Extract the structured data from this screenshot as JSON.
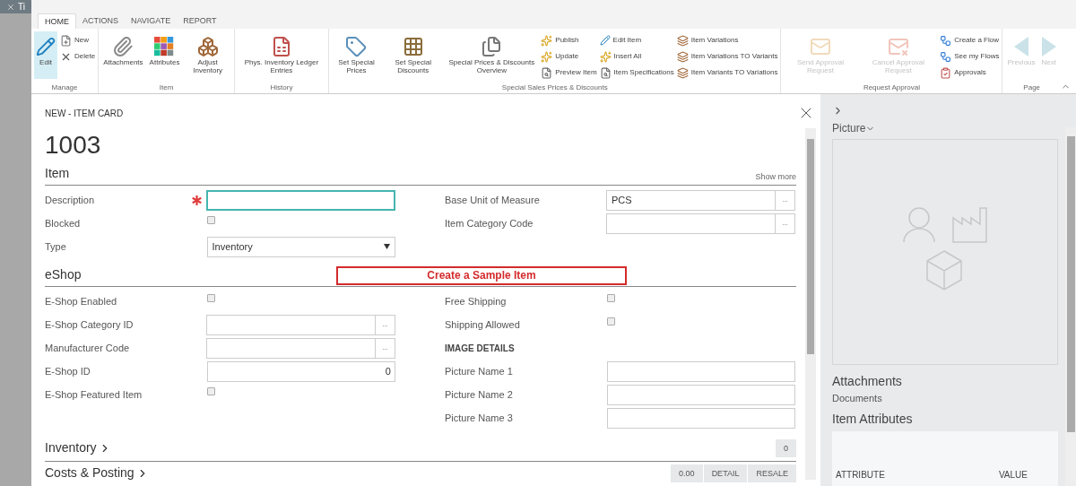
{
  "background": {
    "tab": "Ti"
  },
  "ribbon": {
    "tabs": [
      {
        "label": "HOME",
        "selected": true
      },
      {
        "label": "ACTIONS",
        "selected": false
      },
      {
        "label": "NAVIGATE",
        "selected": false
      },
      {
        "label": "REPORT",
        "selected": false
      }
    ],
    "groups": [
      {
        "label": "Manage",
        "columns": [
          {
            "kind": "large",
            "items": [
              {
                "label": "Edit",
                "selected": true,
                "disabled": false
              }
            ]
          },
          {
            "kind": "stack",
            "items": [
              {
                "label": "New",
                "disabled": false
              },
              {
                "label": "Delete",
                "disabled": false
              }
            ]
          }
        ]
      },
      {
        "label": "Item",
        "columns": [
          {
            "kind": "large",
            "items": [
              {
                "label": "Attachments",
                "selected": false,
                "disabled": false
              }
            ]
          },
          {
            "kind": "large",
            "items": [
              {
                "label": "Attributes",
                "selected": false,
                "disabled": false
              }
            ]
          },
          {
            "kind": "large",
            "items": [
              {
                "label": "Adjust Inventory",
                "selected": false,
                "disabled": false
              }
            ]
          }
        ]
      },
      {
        "label": "History",
        "columns": [
          {
            "kind": "large",
            "items": [
              {
                "label": "Phys. Inventory Ledger Entries",
                "selected": false,
                "disabled": false
              }
            ]
          }
        ]
      },
      {
        "label": "Special Sales Prices & Discounts",
        "columns": [
          {
            "kind": "large",
            "items": [
              {
                "label": "Set Special Prices",
                "selected": false,
                "disabled": false
              }
            ]
          },
          {
            "kind": "large",
            "items": [
              {
                "label": "Set Special Discounts",
                "selected": false,
                "disabled": false
              }
            ]
          },
          {
            "kind": "large",
            "items": [
              {
                "label": "Special Prices & Discounts Overview",
                "selected": false,
                "disabled": false
              }
            ]
          },
          {
            "kind": "stack",
            "items": [
              {
                "label": "Publish",
                "disabled": false
              },
              {
                "label": "Update",
                "disabled": false
              },
              {
                "label": "Preview Item",
                "disabled": false
              }
            ]
          },
          {
            "kind": "stack",
            "items": [
              {
                "label": "Edit Item",
                "disabled": false
              },
              {
                "label": "Insert All",
                "disabled": false
              },
              {
                "label": "Item Specifications",
                "disabled": false
              }
            ]
          },
          {
            "kind": "stack",
            "items": [
              {
                "label": "Item Variations",
                "disabled": false
              },
              {
                "label": "Item Variations TO Variants",
                "disabled": false
              },
              {
                "label": "Item Variants TO Variations",
                "disabled": false
              }
            ]
          }
        ]
      },
      {
        "label": "Request Approval",
        "columns": [
          {
            "kind": "large",
            "items": [
              {
                "label": "Send Approval Request",
                "selected": false,
                "disabled": true
              }
            ]
          },
          {
            "kind": "large",
            "items": [
              {
                "label": "Cancel Approval Request",
                "selected": false,
                "disabled": true
              }
            ]
          },
          {
            "kind": "stack",
            "items": [
              {
                "label": "Create a Flow",
                "disabled": false
              },
              {
                "label": "See my Flows",
                "disabled": false
              },
              {
                "label": "Approvals",
                "disabled": false
              }
            ]
          }
        ]
      },
      {
        "label": "Page",
        "columns": [
          {
            "kind": "large",
            "items": [
              {
                "label": "Previous",
                "selected": false,
                "disabled": true
              }
            ]
          },
          {
            "kind": "large",
            "items": [
              {
                "label": "Next",
                "selected": false,
                "disabled": true
              }
            ]
          }
        ]
      }
    ]
  },
  "card": {
    "caption": "NEW - ITEM CARD",
    "number": "1003",
    "sections": [
      {
        "title": "Item",
        "expanded": true,
        "show_more": "Show more",
        "left": [
          {
            "kind": "text",
            "label": "Description",
            "required": true,
            "focused": true
          },
          {
            "kind": "checkbox",
            "label": "Blocked",
            "checked": false
          },
          {
            "kind": "select",
            "label": "Type",
            "value": "Inventory"
          }
        ],
        "right": [
          {
            "kind": "lookup",
            "label": "Base Unit of Measure",
            "value": "PCS",
            "assist": "..."
          },
          {
            "kind": "lookup",
            "label": "Item Category Code",
            "assist": "..."
          }
        ]
      },
      {
        "title": "eShop",
        "expanded": true,
        "annotation": "Create a Sample Item",
        "left": [
          {
            "kind": "checkbox",
            "label": "E-Shop Enabled",
            "checked": false
          },
          {
            "kind": "lookup",
            "label": "E-Shop Category ID",
            "assist": "..."
          },
          {
            "kind": "lookup",
            "label": "Manufacturer Code",
            "assist": "..."
          },
          {
            "kind": "number",
            "label": "E-Shop ID",
            "value": "0"
          },
          {
            "kind": "checkbox",
            "label": "E-Shop Featured Item",
            "checked": false
          }
        ],
        "right": [
          {
            "kind": "checkbox",
            "label": "Free Shipping",
            "checked": false
          },
          {
            "kind": "checkbox",
            "label": "Shipping Allowed",
            "checked": false
          },
          {
            "kind": "heading",
            "label": "IMAGE DETAILS"
          },
          {
            "kind": "text",
            "label": "Picture Name 1"
          },
          {
            "kind": "text",
            "label": "Picture Name 2"
          },
          {
            "kind": "text",
            "label": "Picture Name 3"
          }
        ]
      },
      {
        "title": "Inventory",
        "expanded": false,
        "badges": [
          "0"
        ]
      },
      {
        "title": "Costs & Posting",
        "expanded": false,
        "badges": [
          "0.00",
          "DETAIL",
          "RESALE"
        ]
      }
    ]
  },
  "factbox": {
    "picture_title": "Picture",
    "attachments_title": "Attachments",
    "attachments_link": "Documents",
    "attributes_title": "Item Attributes",
    "columns": [
      "ATTRIBUTE",
      "VALUE"
    ]
  }
}
